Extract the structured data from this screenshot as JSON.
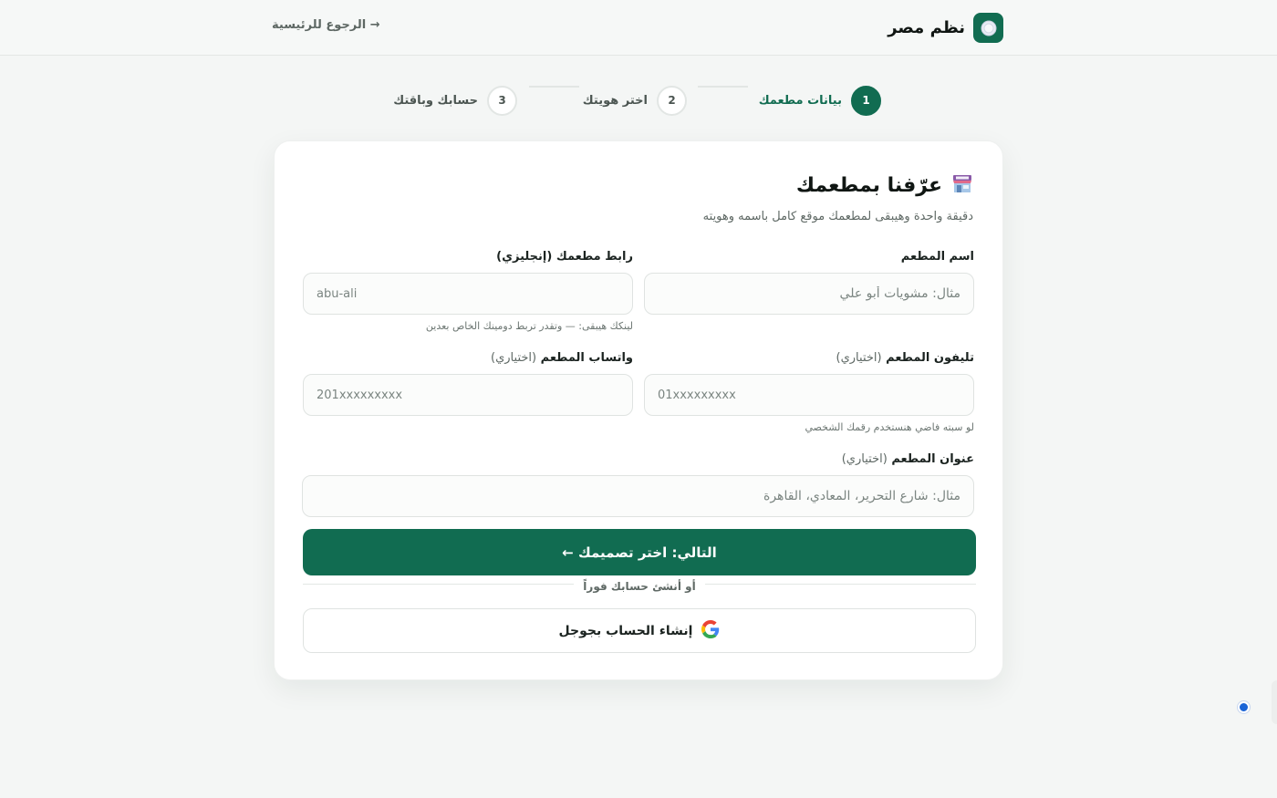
{
  "header": {
    "brand_name": "نظم مصر",
    "logo_icon": "plate-icon",
    "back_link": "→ الرجوع للرئيسية"
  },
  "steps": [
    {
      "number": "1",
      "label": "بيانات مطعمك",
      "state": "active"
    },
    {
      "number": "2",
      "label": "اختر هويتك",
      "state": "pending"
    },
    {
      "number": "3",
      "label": "حسابك وباقتك",
      "state": "pending"
    }
  ],
  "card": {
    "title": "عرّفنا بمطعمك",
    "title_icon": "store-icon",
    "subtitle": "دقيقة واحدة وهيبقى لمطعمك موقع كامل باسمه وهويته"
  },
  "fields": {
    "restaurant_name": {
      "label": "اسم المطعم",
      "placeholder": "مثال: مشويات أبو علي",
      "value": ""
    },
    "restaurant_slug": {
      "label": "رابط مطعمك (إنجليزي)",
      "placeholder": "abu-ali",
      "value": "",
      "hint": "لينكك هيبقى: — وتقدر تربط دومينك الخاص بعدين"
    },
    "restaurant_phone": {
      "label": "تليفون المطعم",
      "optional": "(اختياري)",
      "placeholder": "01xxxxxxxxx",
      "value": "",
      "hint": "لو سبته فاضي هنستخدم رقمك الشخصي"
    },
    "restaurant_whatsapp": {
      "label": "واتساب المطعم",
      "optional": "(اختياري)",
      "placeholder": "201xxxxxxxxx",
      "value": ""
    },
    "restaurant_address": {
      "label": "عنوان المطعم",
      "optional": "(اختياري)",
      "placeholder": "مثال: شارع التحرير، المعادي، القاهرة",
      "value": ""
    }
  },
  "actions": {
    "next_label": "التالي: اختر تصميمك ←",
    "divider_text": "أو أنشئ حسابك فوراً",
    "google_label": "إنشاء الحساب بجوجل",
    "google_icon": "google-icon"
  },
  "colors": {
    "primary": "#116c51",
    "background": "#f4f6f5",
    "card": "#ffffff",
    "border": "#dfe3e1"
  }
}
